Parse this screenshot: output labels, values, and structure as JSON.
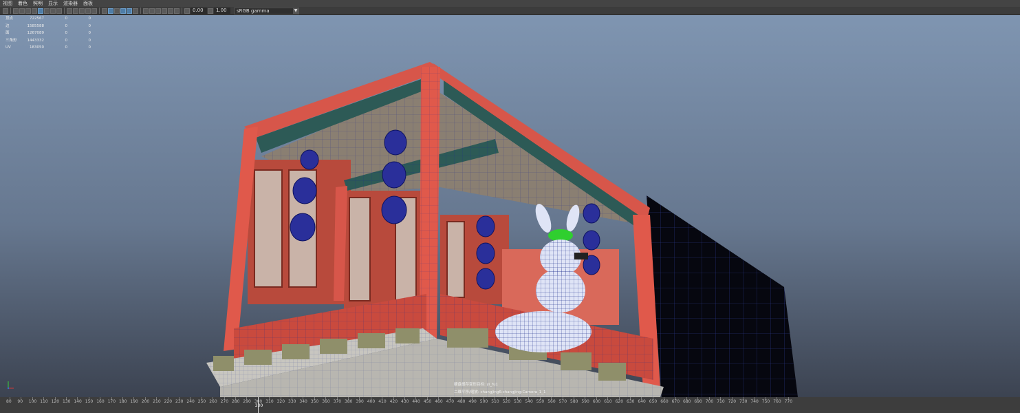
{
  "menu": [
    "视图",
    "着色",
    "照明",
    "显示",
    "渲染器",
    "面板"
  ],
  "toolbar": {
    "exposure": "0.00",
    "gamma": "1.00",
    "color_space": "sRGB gamma"
  },
  "hud": {
    "rows": [
      {
        "label": "顶点",
        "a": "722567",
        "b": "0",
        "c": "0"
      },
      {
        "label": "边",
        "a": "1585588",
        "b": "0",
        "c": "0"
      },
      {
        "label": "面",
        "a": "1267089",
        "b": "0",
        "c": "0"
      },
      {
        "label": "三角形",
        "a": "1443332",
        "b": "0",
        "c": "0"
      },
      {
        "label": "UV",
        "a": "183050",
        "b": "0",
        "c": "0"
      }
    ]
  },
  "camera_info": {
    "line1": "硬盘缓存变形目标: yi_fu1",
    "line2": "二维平移/缩放: changjing6:changjing:Camera_1_1"
  },
  "timeline": {
    "start": 80,
    "end": 770,
    "step": 10,
    "current": "300"
  },
  "colors": {
    "pillar_red": "#e0594b",
    "lantern_blue": "#2a2f9a",
    "mesh_wire": "#1a2a8a",
    "wall_dark": "#06070f"
  }
}
